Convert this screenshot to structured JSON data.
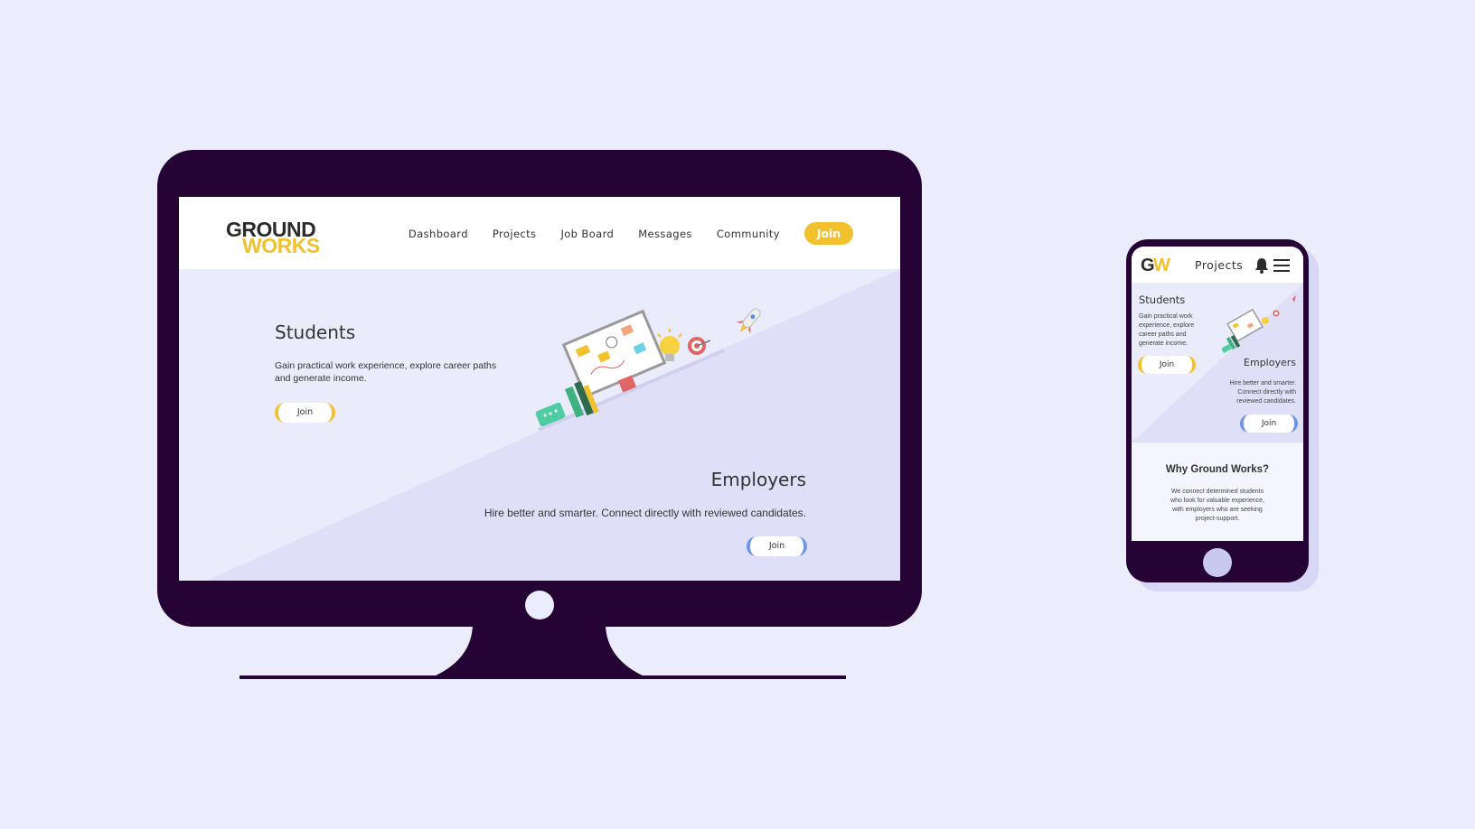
{
  "desktop": {
    "logo": {
      "line1": "GROUND",
      "line2": "WORKS"
    },
    "nav": {
      "items": [
        "Dashboard",
        "Projects",
        "Job Board",
        "Messages",
        "Community"
      ],
      "join_label": "Join"
    },
    "students": {
      "title": "Students",
      "text": "Gain practical work experience, explore career paths and generate income.",
      "join_label": "Join"
    },
    "employers": {
      "title": "Employers",
      "text": "Hire better and smarter. Connect directly with reviewed candidates.",
      "join_label": "Join"
    }
  },
  "mobile": {
    "logo": {
      "g": "G",
      "w": "W"
    },
    "header_title": "Projects",
    "icons": [
      "bell-icon",
      "hamburger-menu-icon"
    ],
    "students": {
      "title": "Students",
      "text": "Gain practical work experience, explore career paths and generate income.",
      "join_label": "Join"
    },
    "employers": {
      "title": "Employers",
      "text": "Hire better and smarter. Connect directly with reviewed candidates.",
      "join_label": "Join"
    },
    "why": {
      "title": "Why Ground Works?",
      "text": "We connect determined students who look for valuable experience, with employers who are seeking project-support."
    }
  },
  "colors": {
    "background": "#ebedfc",
    "device": "#250335",
    "accent_yellow": "#f2c12e",
    "accent_blue": "#6d95e6",
    "triangle": "#dfe0f8"
  }
}
